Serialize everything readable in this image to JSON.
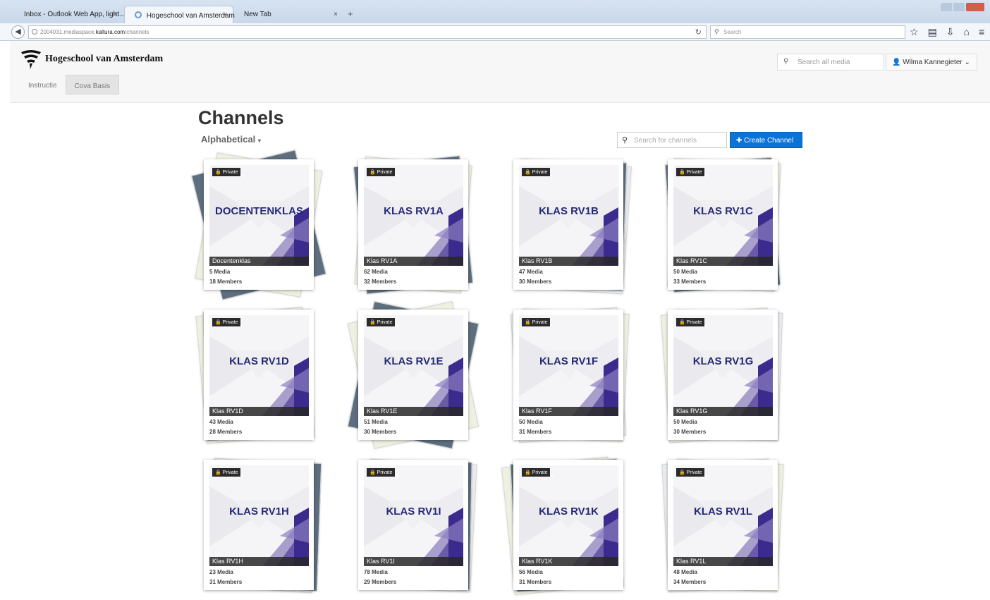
{
  "browser": {
    "tabs": [
      {
        "label": "Inbox - Outlook Web App, light..."
      },
      {
        "label": "Hogeschool van Amsterdam"
      },
      {
        "label": "New Tab"
      }
    ],
    "url_prefix": "2004031.mediaspace.",
    "url_domain": "kaltura.com",
    "url_path": "/channels",
    "search_placeholder": "Search"
  },
  "header": {
    "brand": "Hogeschool van Amsterdam",
    "subnav": [
      "Instructie",
      "Cova Basis"
    ],
    "search_placeholder": "Search all media",
    "user": "Wilma Kannegieter"
  },
  "page": {
    "title": "Channels",
    "sort_label": "Alphabetical",
    "search_placeholder": "Search for channels",
    "create_button": "Create Channel",
    "private_label": "Private"
  },
  "channels": [
    {
      "title": "DOCENTENKLAS",
      "name": "Docentenklas",
      "media": "5 Media",
      "members": "18 Members"
    },
    {
      "title": "KLAS RV1A",
      "name": "Klas RV1A",
      "media": "62 Media",
      "members": "32 Members"
    },
    {
      "title": "KLAS RV1B",
      "name": "Klas RV1B",
      "media": "47 Media",
      "members": "30 Members"
    },
    {
      "title": "KLAS RV1C",
      "name": "Klas RV1C",
      "media": "50 Media",
      "members": "33 Members"
    },
    {
      "title": "KLAS RV1D",
      "name": "Klas RV1D",
      "media": "43 Media",
      "members": "28 Members"
    },
    {
      "title": "KLAS RV1E",
      "name": "Klas RV1E",
      "media": "51 Media",
      "members": "30 Members"
    },
    {
      "title": "KLAS RV1F",
      "name": "Klas RV1F",
      "media": "50 Media",
      "members": "31 Members"
    },
    {
      "title": "KLAS RV1G",
      "name": "Klas RV1G",
      "media": "50 Media",
      "members": "30 Members"
    },
    {
      "title": "KLAS RV1H",
      "name": "Klas RV1H",
      "media": "23 Media",
      "members": "31 Members"
    },
    {
      "title": "KLAS RV1I",
      "name": "Klas RV1I",
      "media": "78 Media",
      "members": "29 Members"
    },
    {
      "title": "KLAS RV1K",
      "name": "Klas RV1K",
      "media": "56 Media",
      "members": "31 Members"
    },
    {
      "title": "KLAS RV1L",
      "name": "Klas RV1L",
      "media": "48 Media",
      "members": "34 Members"
    }
  ],
  "colors": {
    "accent": "#0a73d7",
    "card_title": "#262a74",
    "thumb_purple_dark": "#3b2b8c",
    "thumb_purple_mid": "#6a5aa8",
    "thumb_purple_light": "#a99fcc"
  }
}
